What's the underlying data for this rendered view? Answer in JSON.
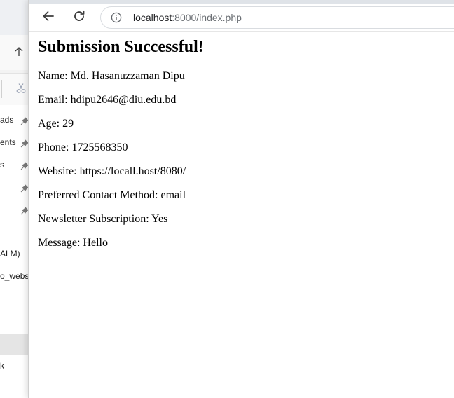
{
  "explorer": {
    "sidebar_items": [
      {
        "label": "ads",
        "pinned": true
      },
      {
        "label": "ents",
        "pinned": true
      },
      {
        "label": "s",
        "pinned": true
      },
      {
        "label": "",
        "pinned": true
      },
      {
        "label": "",
        "pinned": true
      },
      {
        "label": "ALM)",
        "pinned": false
      },
      {
        "label": "o_websi",
        "pinned": false
      },
      {
        "label": "k",
        "pinned": false
      }
    ]
  },
  "browser": {
    "url": {
      "host": "localhost",
      "rest": ":8000/index.php"
    }
  },
  "page": {
    "title": "Submission Successful!",
    "fields": [
      {
        "label": "Name",
        "value": "Md. Hasanuzzaman Dipu",
        "text": "Name: Md. Hasanuzzaman Dipu"
      },
      {
        "label": "Email",
        "value": "hdipu2646@diu.edu.bd",
        "text": "Email: hdipu2646@diu.edu.bd"
      },
      {
        "label": "Age",
        "value": "29",
        "text": "Age: 29"
      },
      {
        "label": "Phone",
        "value": "1725568350",
        "text": "Phone: 1725568350"
      },
      {
        "label": "Website",
        "value": "https://locall.host/8080/",
        "text": "Website: https://locall.host/8080/"
      },
      {
        "label": "Preferred Contact Method",
        "value": "email",
        "text": "Preferred Contact Method: email"
      },
      {
        "label": "Newsletter Subscription",
        "value": "Yes",
        "text": "Newsletter Subscription: Yes"
      },
      {
        "label": "Message",
        "value": "Hello",
        "text": "Message: Hello"
      }
    ]
  }
}
